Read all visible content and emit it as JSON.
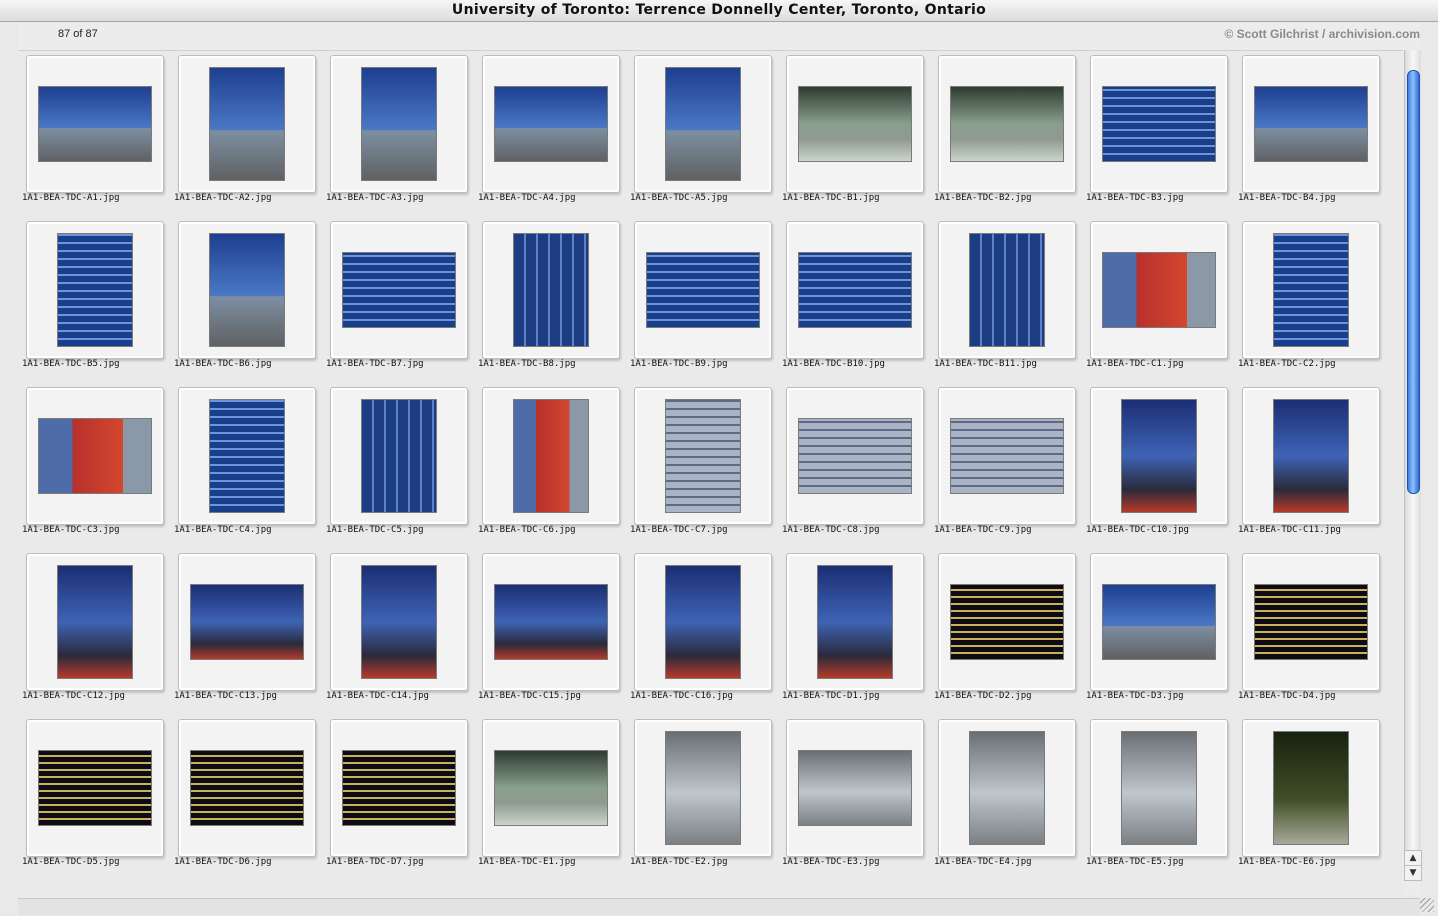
{
  "window": {
    "title": "University of Toronto: Terrence Donnelly Center, Toronto, Ontario"
  },
  "header": {
    "count_text": "87 of 87",
    "credit": "© Scott Gilchrist / archivision.com"
  },
  "scrollbar": {
    "up_icon": "▲",
    "down_icon": "▼"
  },
  "thumbnails": [
    {
      "file": "1A1-BEA-TDC-A1.jpg",
      "orientation": "land",
      "style": "sky"
    },
    {
      "file": "1A1-BEA-TDC-A2.jpg",
      "orientation": "port",
      "style": "sky"
    },
    {
      "file": "1A1-BEA-TDC-A3.jpg",
      "orientation": "port",
      "style": "sky"
    },
    {
      "file": "1A1-BEA-TDC-A4.jpg",
      "orientation": "land",
      "style": "sky"
    },
    {
      "file": "1A1-BEA-TDC-A5.jpg",
      "orientation": "port",
      "style": "sky"
    },
    {
      "file": "1A1-BEA-TDC-B1.jpg",
      "orientation": "land",
      "style": "lobby"
    },
    {
      "file": "1A1-BEA-TDC-B2.jpg",
      "orientation": "land",
      "style": "lobby"
    },
    {
      "file": "1A1-BEA-TDC-B3.jpg",
      "orientation": "land",
      "style": "facade"
    },
    {
      "file": "1A1-BEA-TDC-B4.jpg",
      "orientation": "land",
      "style": "sky"
    },
    {
      "file": "1A1-BEA-TDC-B5.jpg",
      "orientation": "port",
      "style": "facade"
    },
    {
      "file": "1A1-BEA-TDC-B6.jpg",
      "orientation": "port",
      "style": "sky"
    },
    {
      "file": "1A1-BEA-TDC-B7.jpg",
      "orientation": "land",
      "style": "facade"
    },
    {
      "file": "1A1-BEA-TDC-B8.jpg",
      "orientation": "port",
      "style": "facade2"
    },
    {
      "file": "1A1-BEA-TDC-B9.jpg",
      "orientation": "land",
      "style": "facade"
    },
    {
      "file": "1A1-BEA-TDC-B10.jpg",
      "orientation": "land",
      "style": "facade"
    },
    {
      "file": "1A1-BEA-TDC-B11.jpg",
      "orientation": "port",
      "style": "facade2"
    },
    {
      "file": "1A1-BEA-TDC-C1.jpg",
      "orientation": "land",
      "style": "red"
    },
    {
      "file": "1A1-BEA-TDC-C2.jpg",
      "orientation": "port",
      "style": "facade"
    },
    {
      "file": "1A1-BEA-TDC-C3.jpg",
      "orientation": "land",
      "style": "red"
    },
    {
      "file": "1A1-BEA-TDC-C4.jpg",
      "orientation": "port",
      "style": "facade"
    },
    {
      "file": "1A1-BEA-TDC-C5.jpg",
      "orientation": "port",
      "style": "facade2"
    },
    {
      "file": "1A1-BEA-TDC-C6.jpg",
      "orientation": "port",
      "style": "red"
    },
    {
      "file": "1A1-BEA-TDC-C7.jpg",
      "orientation": "port",
      "style": "stripes"
    },
    {
      "file": "1A1-BEA-TDC-C8.jpg",
      "orientation": "land",
      "style": "stripes"
    },
    {
      "file": "1A1-BEA-TDC-C9.jpg",
      "orientation": "land",
      "style": "stripes"
    },
    {
      "file": "1A1-BEA-TDC-C10.jpg",
      "orientation": "port",
      "style": "dusk"
    },
    {
      "file": "1A1-BEA-TDC-C11.jpg",
      "orientation": "port",
      "style": "dusk"
    },
    {
      "file": "1A1-BEA-TDC-C12.jpg",
      "orientation": "port",
      "style": "dusk"
    },
    {
      "file": "1A1-BEA-TDC-C13.jpg",
      "orientation": "land",
      "style": "dusk"
    },
    {
      "file": "1A1-BEA-TDC-C14.jpg",
      "orientation": "port",
      "style": "dusk"
    },
    {
      "file": "1A1-BEA-TDC-C15.jpg",
      "orientation": "land",
      "style": "dusk"
    },
    {
      "file": "1A1-BEA-TDC-C16.jpg",
      "orientation": "port",
      "style": "dusk"
    },
    {
      "file": "1A1-BEA-TDC-D1.jpg",
      "orientation": "port",
      "style": "dusk"
    },
    {
      "file": "1A1-BEA-TDC-D2.jpg",
      "orientation": "land",
      "style": "night"
    },
    {
      "file": "1A1-BEA-TDC-D3.jpg",
      "orientation": "land",
      "style": "sky"
    },
    {
      "file": "1A1-BEA-TDC-D4.jpg",
      "orientation": "land",
      "style": "night"
    },
    {
      "file": "1A1-BEA-TDC-D5.jpg",
      "orientation": "land",
      "style": "night"
    },
    {
      "file": "1A1-BEA-TDC-D6.jpg",
      "orientation": "land",
      "style": "night"
    },
    {
      "file": "1A1-BEA-TDC-D7.jpg",
      "orientation": "land",
      "style": "night"
    },
    {
      "file": "1A1-BEA-TDC-E1.jpg",
      "orientation": "land",
      "style": "lobby"
    },
    {
      "file": "1A1-BEA-TDC-E2.jpg",
      "orientation": "port",
      "style": "interior"
    },
    {
      "file": "1A1-BEA-TDC-E3.jpg",
      "orientation": "land",
      "style": "interior"
    },
    {
      "file": "1A1-BEA-TDC-E4.jpg",
      "orientation": "port",
      "style": "interior"
    },
    {
      "file": "1A1-BEA-TDC-E5.jpg",
      "orientation": "port",
      "style": "interior"
    },
    {
      "file": "1A1-BEA-TDC-E6.jpg",
      "orientation": "port",
      "style": "trees"
    }
  ]
}
